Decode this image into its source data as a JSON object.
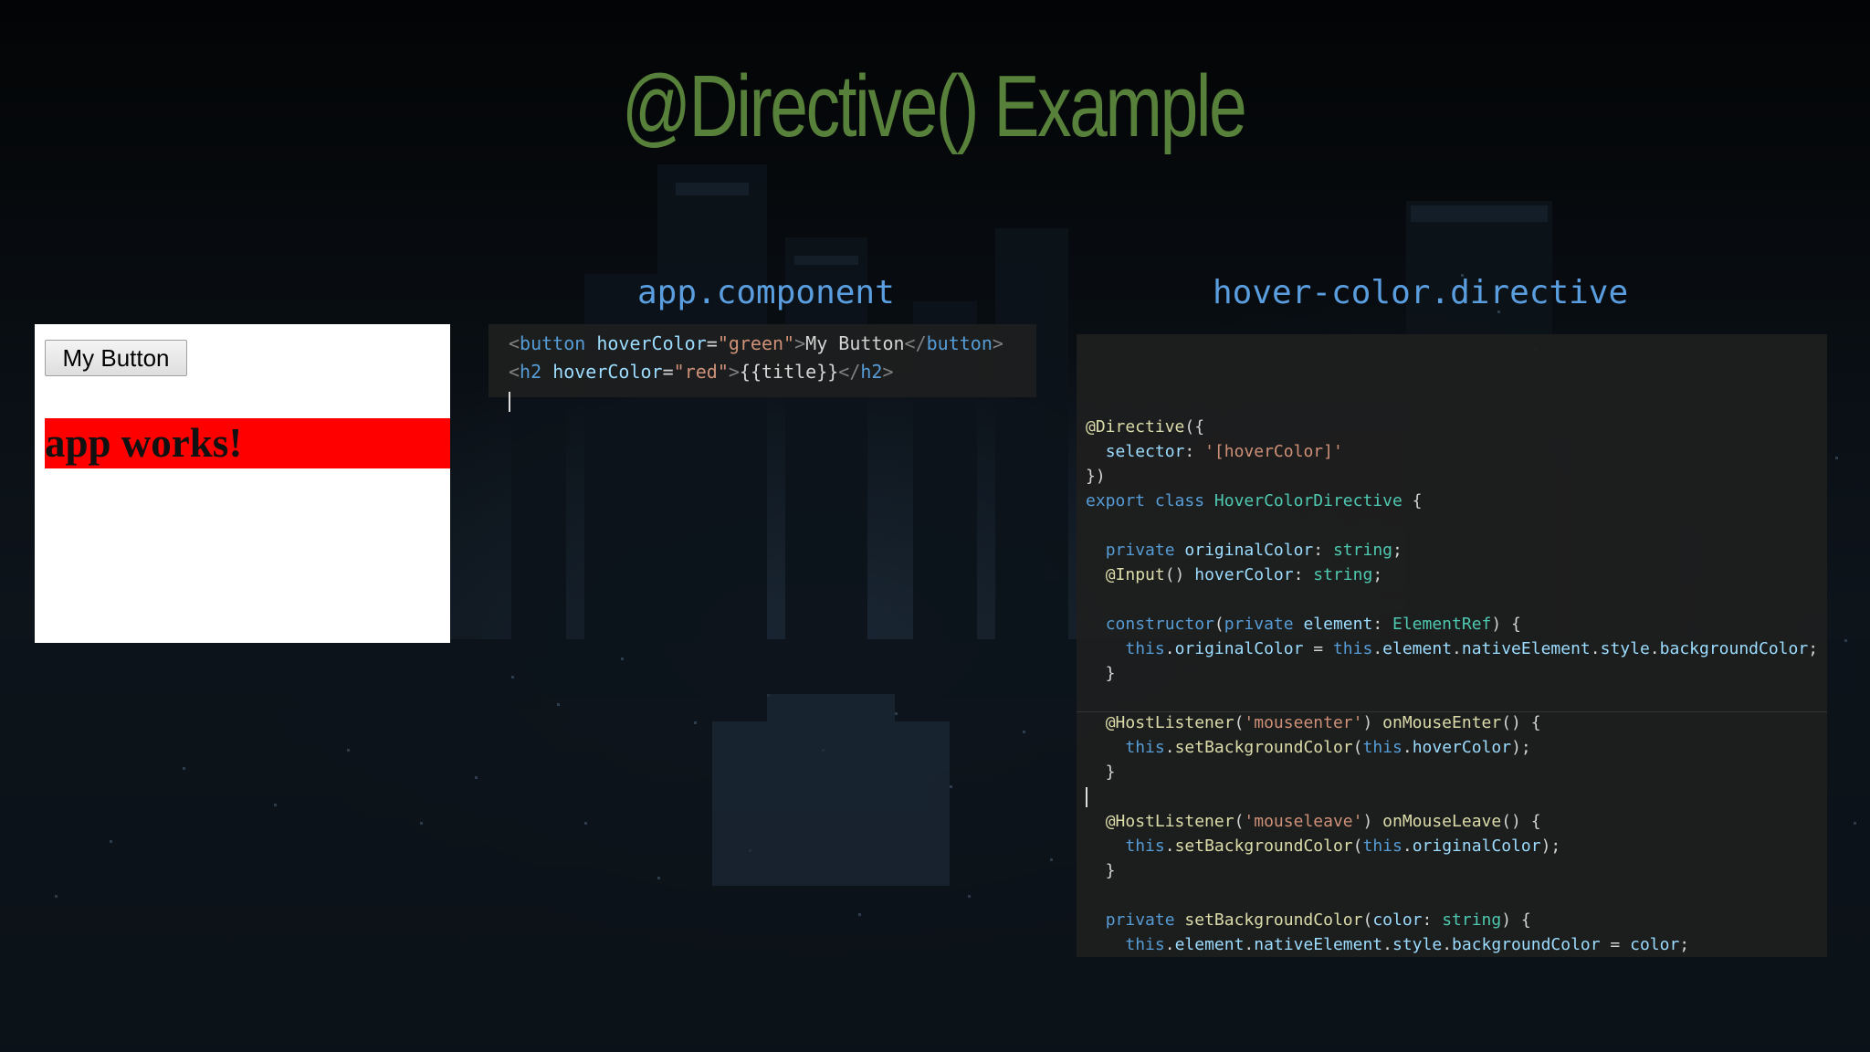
{
  "slide": {
    "title": "@Directive() Example"
  },
  "app_panel": {
    "heading": "app.component",
    "lines": [
      [
        {
          "t": "tag",
          "v": "<"
        },
        {
          "t": "name",
          "v": "button"
        },
        {
          "t": "plain",
          "v": " "
        },
        {
          "t": "attr",
          "v": "hoverColor"
        },
        {
          "t": "plain",
          "v": "="
        },
        {
          "t": "str",
          "v": "\"green\""
        },
        {
          "t": "tag",
          "v": ">"
        },
        {
          "t": "txt",
          "v": "My Button"
        },
        {
          "t": "tag",
          "v": "</"
        },
        {
          "t": "name",
          "v": "button"
        },
        {
          "t": "tag",
          "v": ">"
        }
      ],
      [
        {
          "t": "tag",
          "v": "<"
        },
        {
          "t": "name",
          "v": "h2"
        },
        {
          "t": "plain",
          "v": " "
        },
        {
          "t": "attr",
          "v": "hoverColor"
        },
        {
          "t": "plain",
          "v": "="
        },
        {
          "t": "str",
          "v": "\"red\""
        },
        {
          "t": "tag",
          "v": ">"
        },
        {
          "t": "txt",
          "v": "{{title}}"
        },
        {
          "t": "tag",
          "v": "</"
        },
        {
          "t": "name",
          "v": "h2"
        },
        {
          "t": "tag",
          "v": ">"
        }
      ]
    ]
  },
  "preview": {
    "button_label": "My Button",
    "heading_text": "app works!",
    "heading_bg": "#ff0000"
  },
  "directive_panel": {
    "heading": "hover-color.directive",
    "lines": [
      [
        {
          "t": "fn",
          "v": "@Directive"
        },
        {
          "t": "plain",
          "v": "({"
        }
      ],
      [
        {
          "t": "plain",
          "v": "  "
        },
        {
          "t": "prop",
          "v": "selector"
        },
        {
          "t": "plain",
          "v": ": "
        },
        {
          "t": "str",
          "v": "'[hoverColor]'"
        }
      ],
      [
        {
          "t": "plain",
          "v": "})"
        }
      ],
      [
        {
          "t": "kw",
          "v": "export"
        },
        {
          "t": "plain",
          "v": " "
        },
        {
          "t": "kw",
          "v": "class"
        },
        {
          "t": "plain",
          "v": " "
        },
        {
          "t": "cls",
          "v": "HoverColorDirective"
        },
        {
          "t": "plain",
          "v": " {"
        }
      ],
      [],
      [
        {
          "t": "plain",
          "v": "  "
        },
        {
          "t": "kw",
          "v": "private"
        },
        {
          "t": "plain",
          "v": " "
        },
        {
          "t": "prop",
          "v": "originalColor"
        },
        {
          "t": "plain",
          "v": ": "
        },
        {
          "t": "cls",
          "v": "string"
        },
        {
          "t": "plain",
          "v": ";"
        }
      ],
      [
        {
          "t": "plain",
          "v": "  "
        },
        {
          "t": "fn",
          "v": "@Input"
        },
        {
          "t": "plain",
          "v": "() "
        },
        {
          "t": "prop",
          "v": "hoverColor"
        },
        {
          "t": "plain",
          "v": ": "
        },
        {
          "t": "cls",
          "v": "string"
        },
        {
          "t": "plain",
          "v": ";"
        }
      ],
      [],
      [
        {
          "t": "plain",
          "v": "  "
        },
        {
          "t": "kw",
          "v": "constructor"
        },
        {
          "t": "plain",
          "v": "("
        },
        {
          "t": "kw",
          "v": "private"
        },
        {
          "t": "plain",
          "v": " "
        },
        {
          "t": "prop",
          "v": "element"
        },
        {
          "t": "plain",
          "v": ": "
        },
        {
          "t": "cls",
          "v": "ElementRef"
        },
        {
          "t": "plain",
          "v": ") {"
        }
      ],
      [
        {
          "t": "plain",
          "v": "    "
        },
        {
          "t": "kw",
          "v": "this"
        },
        {
          "t": "plain",
          "v": "."
        },
        {
          "t": "prop",
          "v": "originalColor"
        },
        {
          "t": "plain",
          "v": " = "
        },
        {
          "t": "kw",
          "v": "this"
        },
        {
          "t": "plain",
          "v": "."
        },
        {
          "t": "prop",
          "v": "element"
        },
        {
          "t": "plain",
          "v": "."
        },
        {
          "t": "prop",
          "v": "nativeElement"
        },
        {
          "t": "plain",
          "v": "."
        },
        {
          "t": "prop",
          "v": "style"
        },
        {
          "t": "plain",
          "v": "."
        },
        {
          "t": "prop",
          "v": "backgroundColor"
        },
        {
          "t": "plain",
          "v": ";"
        }
      ],
      [
        {
          "t": "plain",
          "v": "  }"
        }
      ],
      [],
      [
        {
          "t": "plain",
          "v": "  "
        },
        {
          "t": "fn",
          "v": "@HostListener"
        },
        {
          "t": "plain",
          "v": "("
        },
        {
          "t": "str",
          "v": "'mouseenter'"
        },
        {
          "t": "plain",
          "v": ") "
        },
        {
          "t": "fn",
          "v": "onMouseEnter"
        },
        {
          "t": "plain",
          "v": "() {"
        }
      ],
      [
        {
          "t": "plain",
          "v": "    "
        },
        {
          "t": "kw",
          "v": "this"
        },
        {
          "t": "plain",
          "v": "."
        },
        {
          "t": "fn",
          "v": "setBackgroundColor"
        },
        {
          "t": "plain",
          "v": "("
        },
        {
          "t": "kw",
          "v": "this"
        },
        {
          "t": "plain",
          "v": "."
        },
        {
          "t": "prop",
          "v": "hoverColor"
        },
        {
          "t": "plain",
          "v": ");"
        }
      ],
      [
        {
          "t": "plain",
          "v": "  }"
        }
      ],
      [],
      [
        {
          "t": "plain",
          "v": "  "
        },
        {
          "t": "fn",
          "v": "@HostListener"
        },
        {
          "t": "plain",
          "v": "("
        },
        {
          "t": "str",
          "v": "'mouseleave'"
        },
        {
          "t": "plain",
          "v": ") "
        },
        {
          "t": "fn",
          "v": "onMouseLeave"
        },
        {
          "t": "plain",
          "v": "() {"
        }
      ],
      [
        {
          "t": "plain",
          "v": "    "
        },
        {
          "t": "kw",
          "v": "this"
        },
        {
          "t": "plain",
          "v": "."
        },
        {
          "t": "fn",
          "v": "setBackgroundColor"
        },
        {
          "t": "plain",
          "v": "("
        },
        {
          "t": "kw",
          "v": "this"
        },
        {
          "t": "plain",
          "v": "."
        },
        {
          "t": "prop",
          "v": "originalColor"
        },
        {
          "t": "plain",
          "v": ");"
        }
      ],
      [
        {
          "t": "plain",
          "v": "  }"
        }
      ],
      [],
      [
        {
          "t": "plain",
          "v": "  "
        },
        {
          "t": "kw",
          "v": "private"
        },
        {
          "t": "plain",
          "v": " "
        },
        {
          "t": "fn",
          "v": "setBackgroundColor"
        },
        {
          "t": "plain",
          "v": "("
        },
        {
          "t": "prop",
          "v": "color"
        },
        {
          "t": "plain",
          "v": ": "
        },
        {
          "t": "cls",
          "v": "string"
        },
        {
          "t": "plain",
          "v": ") {"
        }
      ],
      [
        {
          "t": "plain",
          "v": "    "
        },
        {
          "t": "kw",
          "v": "this"
        },
        {
          "t": "plain",
          "v": "."
        },
        {
          "t": "prop",
          "v": "element"
        },
        {
          "t": "plain",
          "v": "."
        },
        {
          "t": "prop",
          "v": "nativeElement"
        },
        {
          "t": "plain",
          "v": "."
        },
        {
          "t": "prop",
          "v": "style"
        },
        {
          "t": "plain",
          "v": "."
        },
        {
          "t": "prop",
          "v": "backgroundColor"
        },
        {
          "t": "plain",
          "v": " = "
        },
        {
          "t": "prop",
          "v": "color"
        },
        {
          "t": "plain",
          "v": ";"
        }
      ],
      [
        {
          "t": "plain",
          "v": "  }"
        }
      ],
      [],
      [],
      [
        {
          "t": "plain",
          "v": "}"
        }
      ]
    ]
  },
  "colors": {
    "title": "#57803a",
    "panel_heading": "#5a9ee0",
    "code_bg": "#1e1e1e"
  }
}
